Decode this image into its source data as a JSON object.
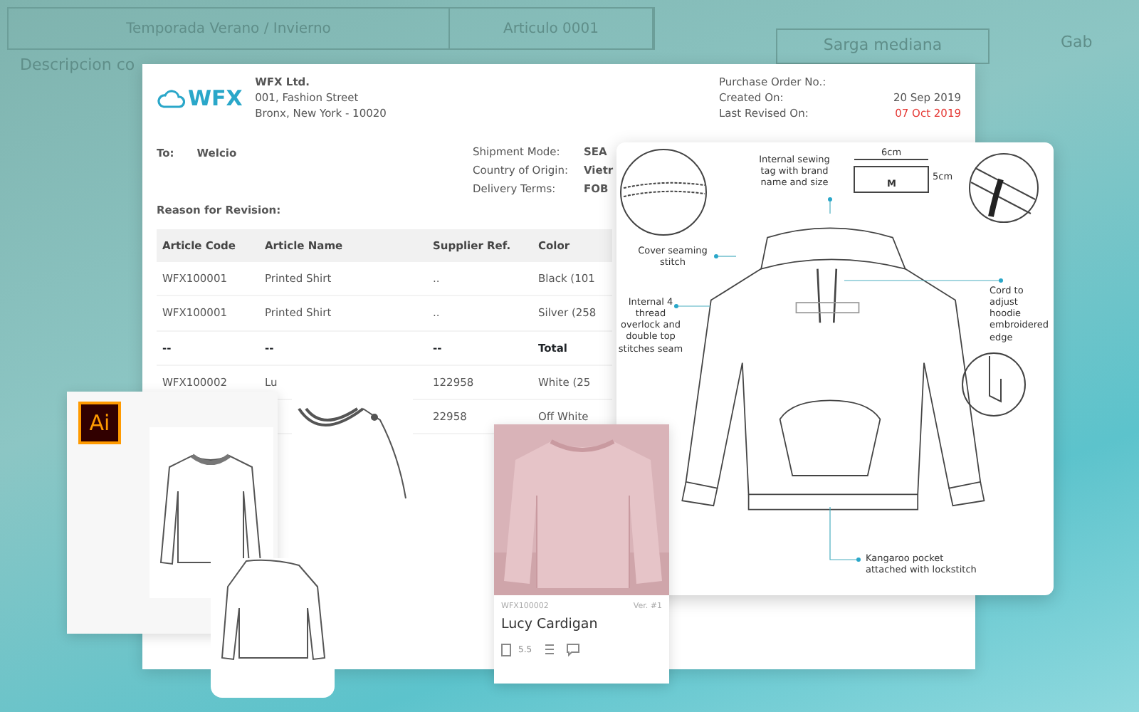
{
  "background_sheet": {
    "cells": [
      "Temporada  Verano / Invierno",
      "Articulo  0001",
      "Descripcion co",
      "Sarga mediana",
      "Gab"
    ]
  },
  "purchase_order": {
    "logo": "WFX",
    "company": [
      "WFX Ltd.",
      "001, Fashion Street",
      "Bronx, New York - 10020"
    ],
    "order_fields": [
      {
        "label": "Purchase Order No.:"
      },
      {
        "label": "Created On:",
        "value": "20 Sep 2019",
        "highlight": false
      },
      {
        "label": "Last Revised On:",
        "value": "07 Oct 2019",
        "highlight": true
      }
    ],
    "to_label": "To:",
    "to_value": "Welcio",
    "shipping": [
      {
        "label": "Shipment Mode:",
        "value": "SEA"
      },
      {
        "label": "Country of Origin:",
        "value": "Vietr"
      },
      {
        "label": "Delivery Terms:",
        "value": "FOB"
      }
    ],
    "reason_label": "Reason for Revision:",
    "table": {
      "columns": [
        "Article Code",
        "Article Name",
        "Supplier Ref.",
        "Color"
      ],
      "rows": [
        {
          "cells": [
            "WFX100001",
            "Printed Shirt",
            "..",
            "Black (101"
          ],
          "kind": "item"
        },
        {
          "cells": [
            "WFX100001",
            "Printed Shirt",
            "..",
            "Silver (258"
          ],
          "kind": "item"
        },
        {
          "cells": [
            "--",
            "--",
            "--",
            "Total"
          ],
          "kind": "total"
        },
        {
          "cells": [
            "WFX100002",
            "Lu",
            "122958",
            "White (25"
          ],
          "kind": "item"
        },
        {
          "cells": [
            null,
            null,
            "22958",
            "Off White"
          ],
          "kind": "item"
        }
      ]
    }
  },
  "tech_pack": {
    "tag_width": "6cm",
    "tag_height": "5cm",
    "tag_size": "M",
    "callouts": [
      "Internal sewing tag with brand name and size",
      "Cover seaming stitch",
      "Internal 4 thread overlock and double top stitches seam",
      "Cord to adjust hoodie embroidered edge",
      "Kangaroo pocket attached with lockstitch"
    ]
  },
  "illustrator_card": {
    "app_badge": "Ai"
  },
  "product_card": {
    "code": "WFX100002",
    "version": "Ver. #1",
    "name": "Lucy Cardigan",
    "count": "5.5"
  }
}
